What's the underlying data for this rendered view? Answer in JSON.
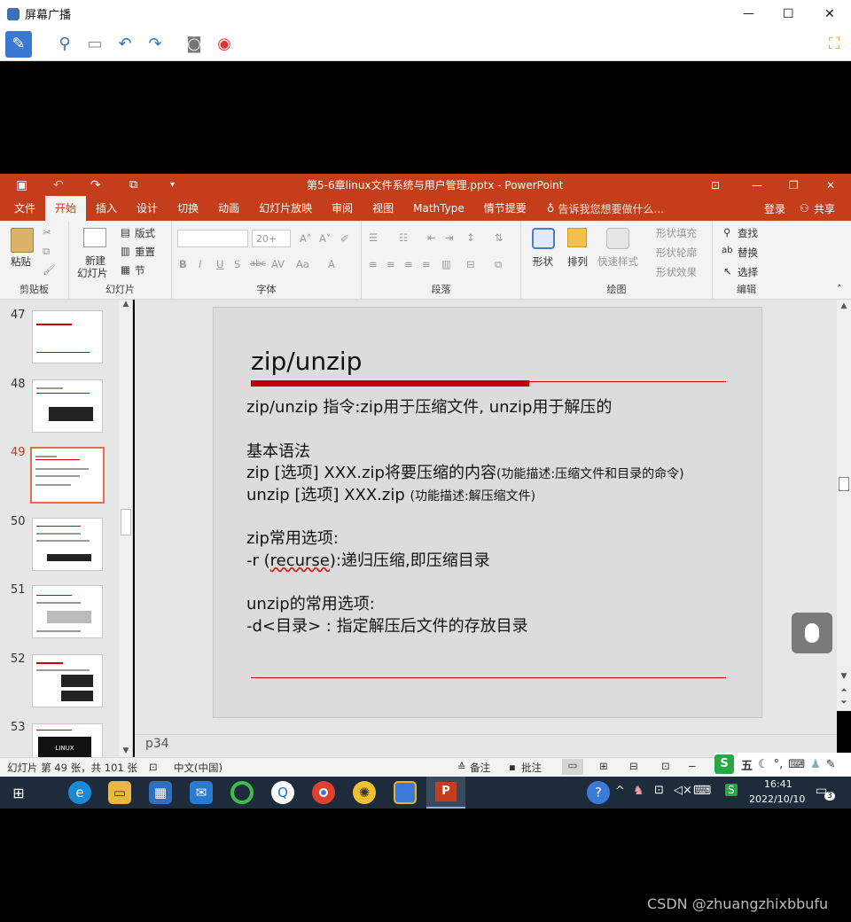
{
  "app_title": "屏幕广播",
  "window_controls": {
    "minimize": "—",
    "maximize": "☐",
    "close": "✕"
  },
  "ppt": {
    "title": "第5-6章linux文件系统与用户管理.pptx - PowerPoint",
    "tabs": [
      "文件",
      "开始",
      "插入",
      "设计",
      "切换",
      "动画",
      "幻灯片放映",
      "审阅",
      "视图",
      "MathType",
      "情节提要"
    ],
    "active_tab": "开始",
    "tell_me": "告诉我您想要做什么...",
    "login": "登录",
    "share": "共享"
  },
  "ribbon": {
    "clipboard": {
      "label": "剪贴板",
      "paste": "粘贴"
    },
    "slides": {
      "label": "幻灯片",
      "new_slide": "新建",
      "new_slide2": "幻灯片",
      "layout": "版式",
      "reset": "重置",
      "section": "节"
    },
    "font": {
      "label": "字体",
      "size": "20+"
    },
    "paragraph": {
      "label": "段落"
    },
    "drawing": {
      "label": "绘图",
      "shapes": "形状",
      "arrange": "排列",
      "quick_styles": "快速样式",
      "fill": "形状填充",
      "outline": "形状轮廓",
      "effects": "形状效果"
    },
    "editing": {
      "label": "编辑",
      "find": "查找",
      "replace": "替换",
      "select": "选择"
    }
  },
  "thumbnails": [
    {
      "num": "47",
      "selected": false
    },
    {
      "num": "48",
      "selected": false
    },
    {
      "num": "49",
      "selected": true
    },
    {
      "num": "50",
      "selected": false
    },
    {
      "num": "51",
      "selected": false
    },
    {
      "num": "52",
      "selected": false
    },
    {
      "num": "53",
      "selected": false
    }
  ],
  "thumb_logo": "LINUX",
  "slide": {
    "title": "zip/unzip",
    "line1": "zip/unzip 指令:zip用于压缩文件, unzip用于解压的",
    "syntax_heading": "基本语法",
    "syntax_zip_main": "zip [选项] XXX.zip将要压缩的内容",
    "syntax_zip_note": "(功能描述:压缩文件和目录的命令)",
    "syntax_unzip_main": "unzip [选项] XXX.zip ",
    "syntax_unzip_note": "(功能描述:解压缩文件)",
    "zip_opts_heading": "zip常用选项:",
    "zip_opt_prefix": "-r (",
    "zip_opt_word": "recurse",
    "zip_opt_rest": "):递归压缩,即压缩目录",
    "unzip_opts_heading": "unzip的常用选项:",
    "unzip_opt": "-d<目录> : 指定解压后文件的存放目录"
  },
  "notes": "p34",
  "status": {
    "slide_info": "幻灯片 第 49 张，共 101 张",
    "language": "中文(中国)",
    "notes": "备注",
    "comments": "批注"
  },
  "ime": {
    "mode": "五"
  },
  "clock": {
    "time": "16:41",
    "date": "2022/10/10",
    "notif_count": "3"
  },
  "watermark": "CSDN @zhuangzhixbbufu",
  "colors": {
    "ppt_red": "#c43e1c",
    "accent_red": "#c00000",
    "thumb_select": "#e0704a"
  }
}
